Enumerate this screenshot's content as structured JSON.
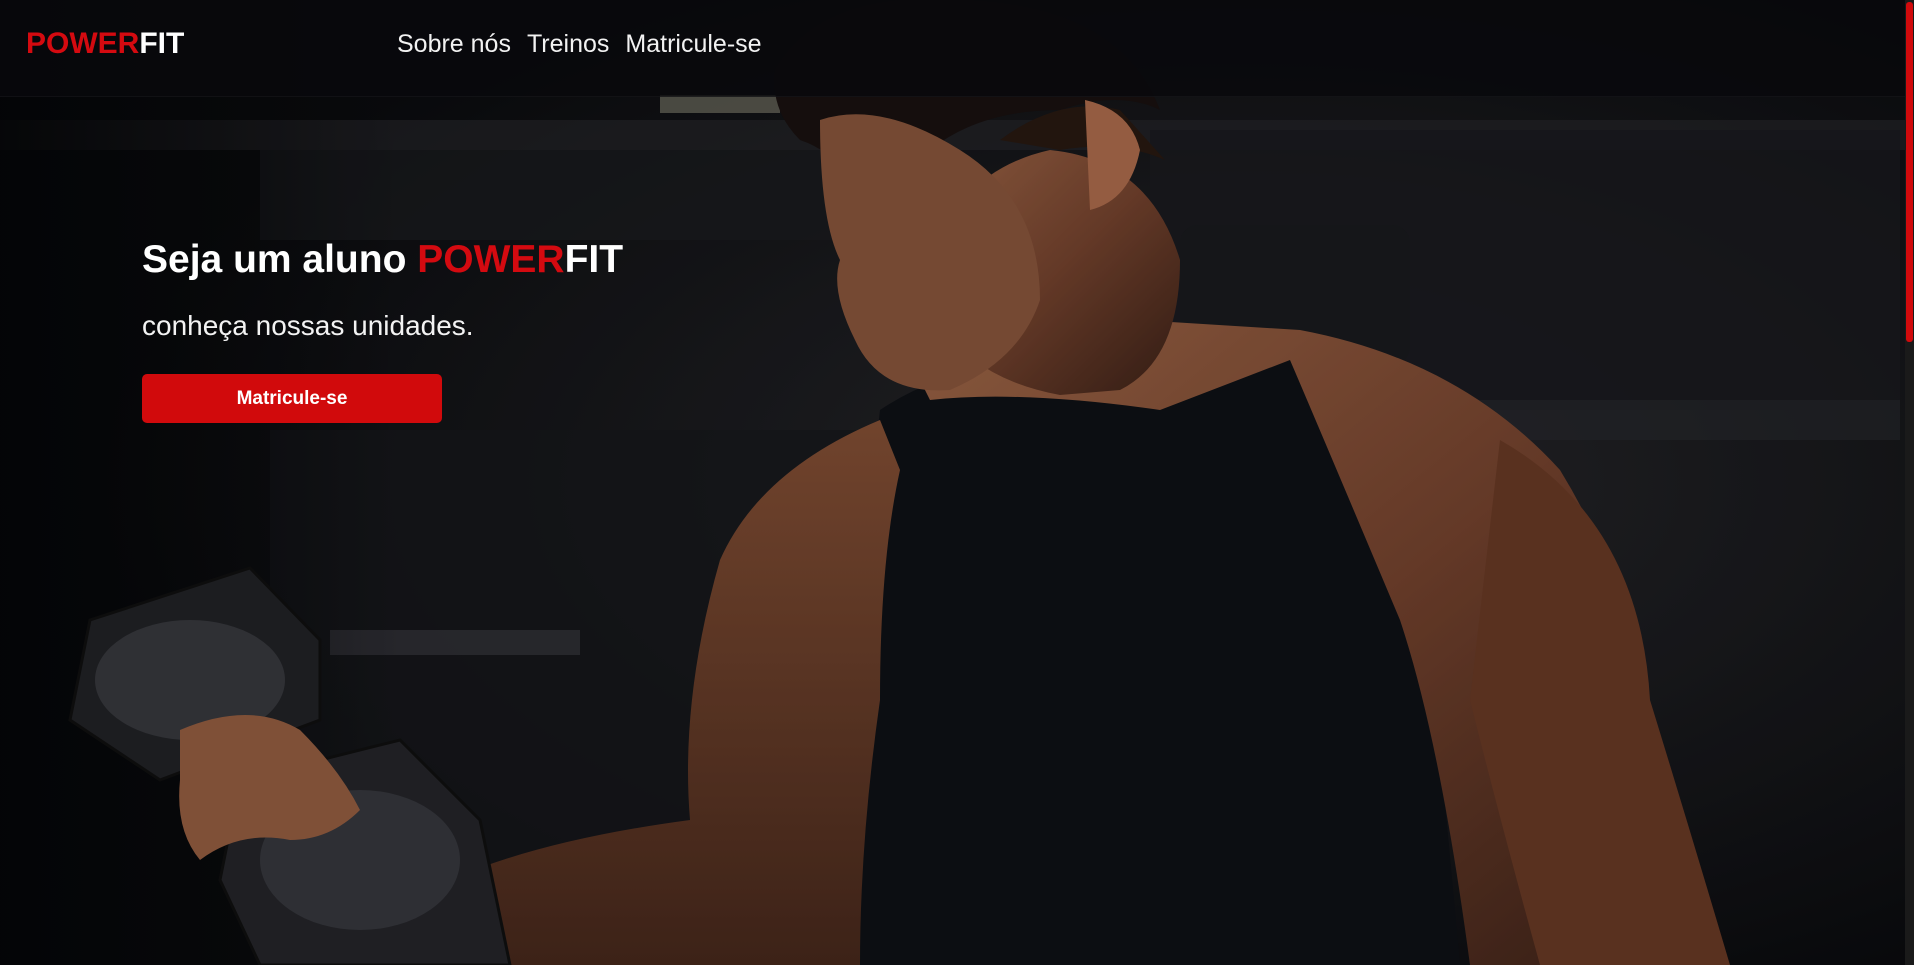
{
  "header": {
    "logo_power": "POWER",
    "logo_fit": "FIT",
    "nav": [
      "Sobre nós",
      "Treinos",
      "Matricule-se"
    ]
  },
  "hero": {
    "title_prefix": "Seja um aluno ",
    "title_power": "POWER",
    "title_fit": "FIT",
    "subtitle": "conheça nossas unidades.",
    "cta_label": "Matricule-se"
  },
  "colors": {
    "brand_red": "#d40a10",
    "text_white": "#ffffff",
    "background_dark": "#0b0c10"
  },
  "icons": []
}
